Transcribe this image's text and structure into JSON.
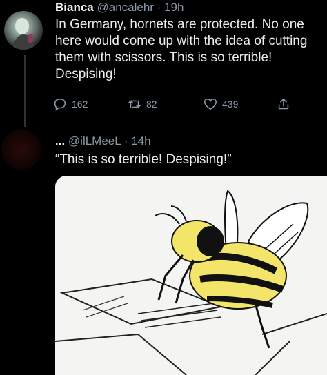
{
  "tweet": {
    "name": "Bianca",
    "handle": "@ancalehr",
    "separator": "·",
    "time": "19h",
    "text": "In Germany, hornets are protected. No one\nhere would come up with the idea of cutting\nthem with scissors. This is so terrible!\nDespising!",
    "actions": {
      "replies": "162",
      "retweets": "82",
      "likes": "439"
    }
  },
  "reply": {
    "name": "...",
    "handle": "@ilLMeeL",
    "separator": "·",
    "time": "14h",
    "text": "“This is so terrible! Despising!”"
  },
  "colors": {
    "background": "#000000",
    "text": "#e7e9ea",
    "meta": "#8b98a5"
  }
}
